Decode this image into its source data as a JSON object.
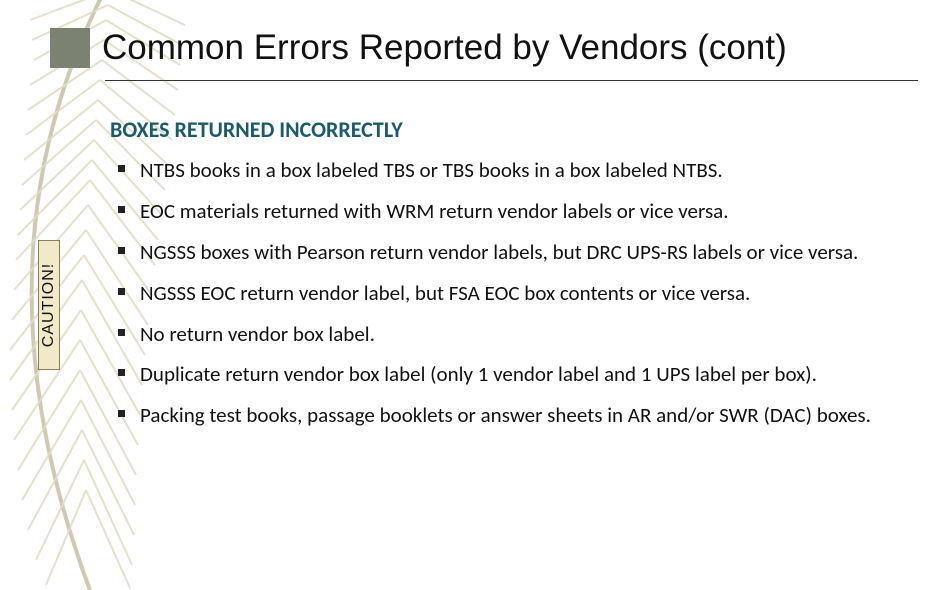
{
  "title": "Common Errors  Reported by Vendors (cont)",
  "section_heading": "BOXES RETURNED INCORRECTLY",
  "caution_label": "CAUTION!",
  "bullets": [
    "NTBS books in a box labeled TBS or TBS books in a box labeled NTBS.",
    "EOC materials returned with WRM return vendor labels or vice versa.",
    "NGSSS boxes with Pearson return vendor labels, but DRC UPS-RS labels or vice versa.",
    "NGSSS EOC return vendor label, but FSA EOC box contents or vice versa.",
    "No return vendor box label.",
    "Duplicate return vendor box label (only 1 vendor label and 1 UPS label per box).",
    "Packing test books, passage booklets or answer sheets in AR and/or SWR (DAC) boxes."
  ]
}
